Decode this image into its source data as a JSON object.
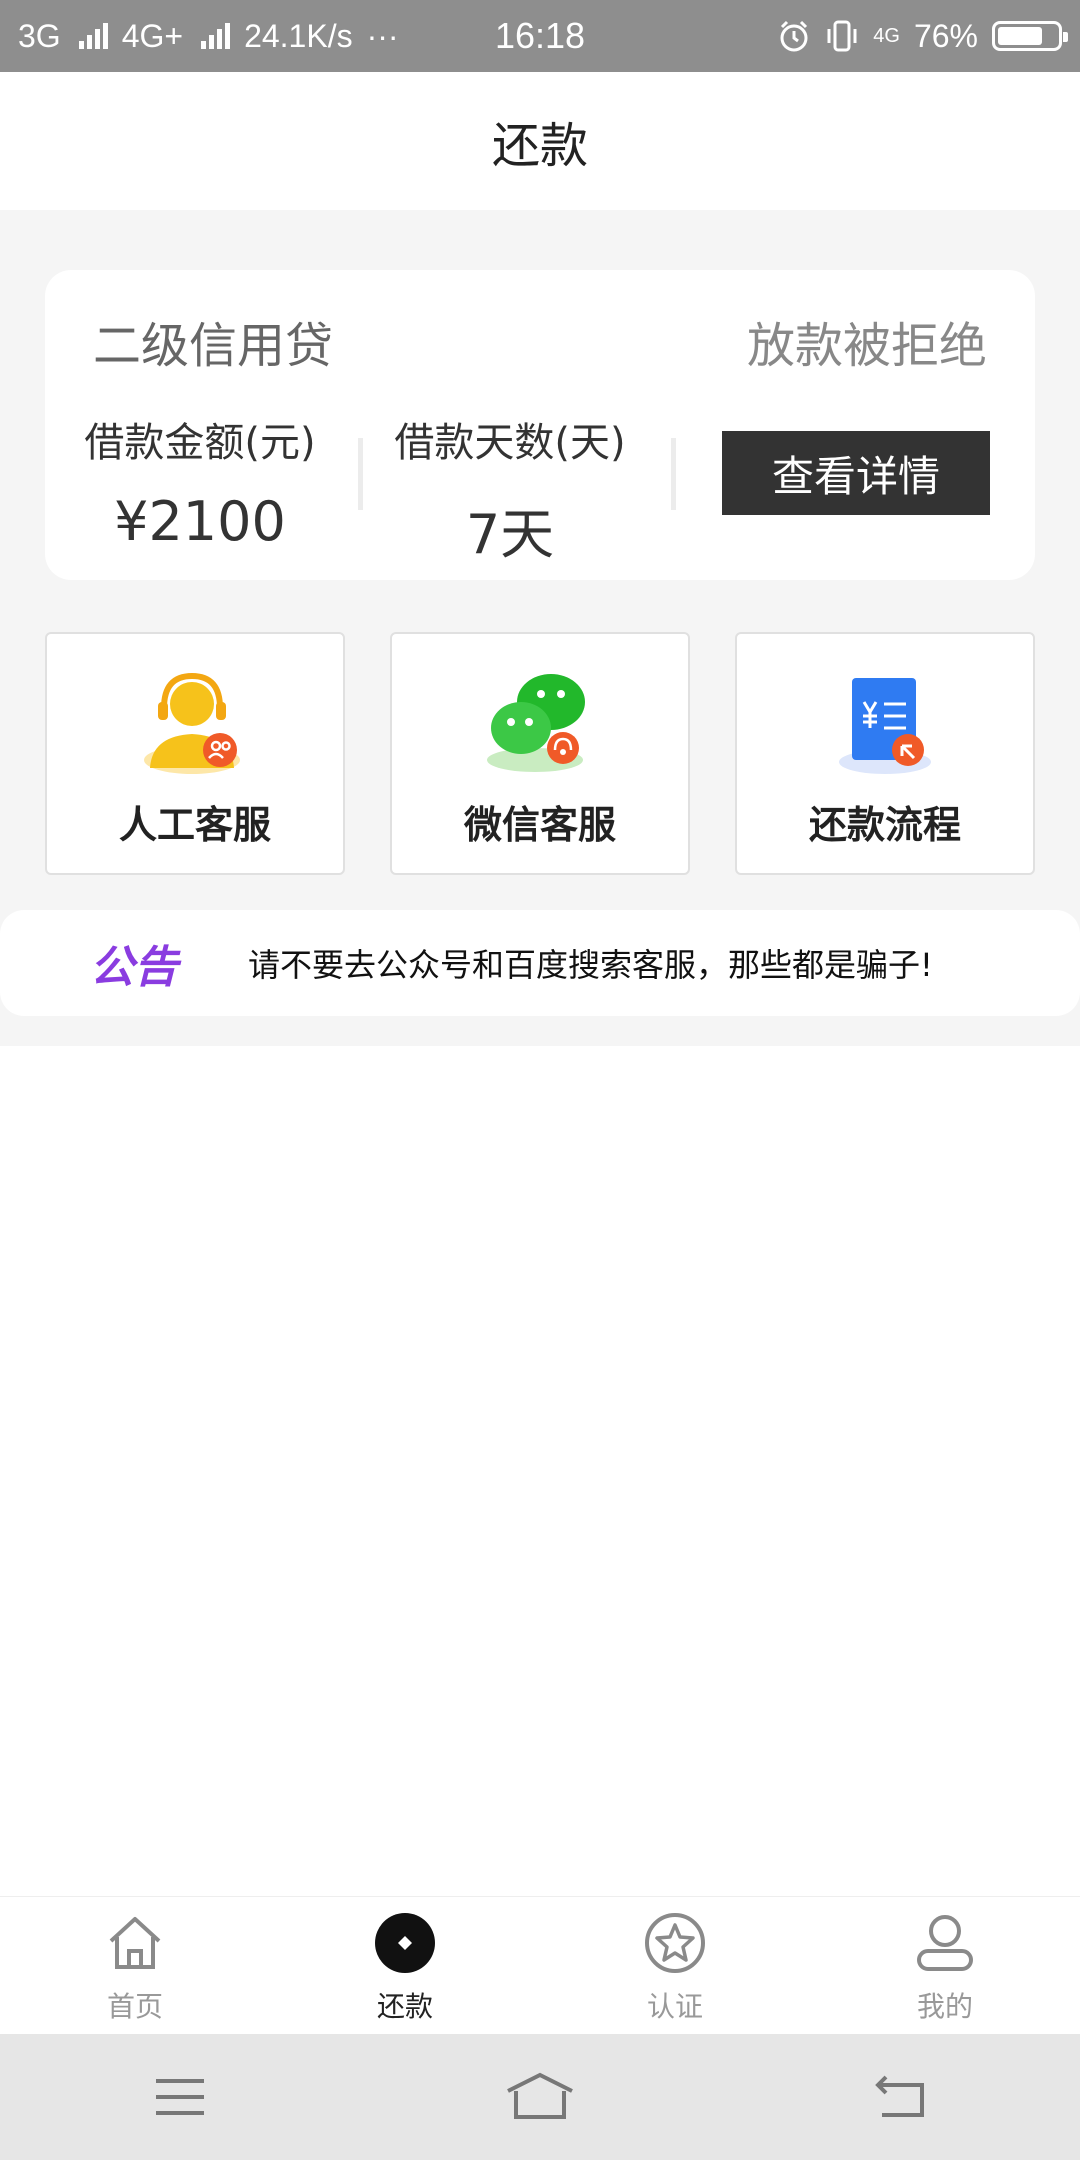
{
  "status_bar": {
    "net1": "3G",
    "net2": "4G+",
    "speed": "24.1K/s",
    "dots": "···",
    "time": "16:18",
    "lte": "4G",
    "battery": "76%",
    "battery_level": 0.76
  },
  "header": {
    "title": "还款"
  },
  "loan_card": {
    "product_name": "二级信用贷",
    "status": "放款被拒绝",
    "amount_label": "借款金额(元)",
    "amount_value": "¥2100",
    "days_label": "借款天数(天)",
    "days_value": "7天",
    "detail_button": "查看详情"
  },
  "services": [
    {
      "label": "人工客服",
      "icon": "customer-service-icon"
    },
    {
      "label": "微信客服",
      "icon": "wechat-icon"
    },
    {
      "label": "还款流程",
      "icon": "repayment-doc-icon"
    }
  ],
  "notice": {
    "badge": "公告",
    "text": "请不要去公众号和百度搜索客服，那些都是骗子!"
  },
  "bottom_nav": {
    "items": [
      {
        "label": "首页",
        "icon": "home-icon",
        "active": false
      },
      {
        "label": "还款",
        "icon": "repay-icon",
        "active": true
      },
      {
        "label": "认证",
        "icon": "star-badge-icon",
        "active": false
      },
      {
        "label": "我的",
        "icon": "user-icon",
        "active": false
      }
    ]
  },
  "colors": {
    "accent_dark": "#333333",
    "notice_purple": "#8a3ce0",
    "status_bar": "#8e8e8e"
  }
}
